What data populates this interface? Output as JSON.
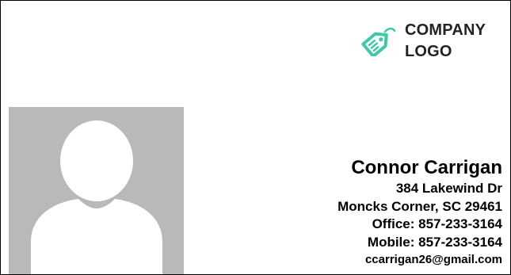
{
  "logo": {
    "icon": "price-tag-icon",
    "line1": "COMPANY",
    "line2": "LOGO",
    "accent_color": "#3fc8a8"
  },
  "photo": {
    "icon": "person-silhouette-icon",
    "background_color": "#b9b9b9",
    "silhouette_color": "#ffffff"
  },
  "contact": {
    "name": "Connor Carrigan",
    "street": "384 Lakewind Dr",
    "city_state_zip": "Moncks Corner, SC 29461",
    "office": "Office: 857-233-3164",
    "mobile": "Mobile: 857-233-3164",
    "email": "ccarrigan26@gmail.com"
  }
}
